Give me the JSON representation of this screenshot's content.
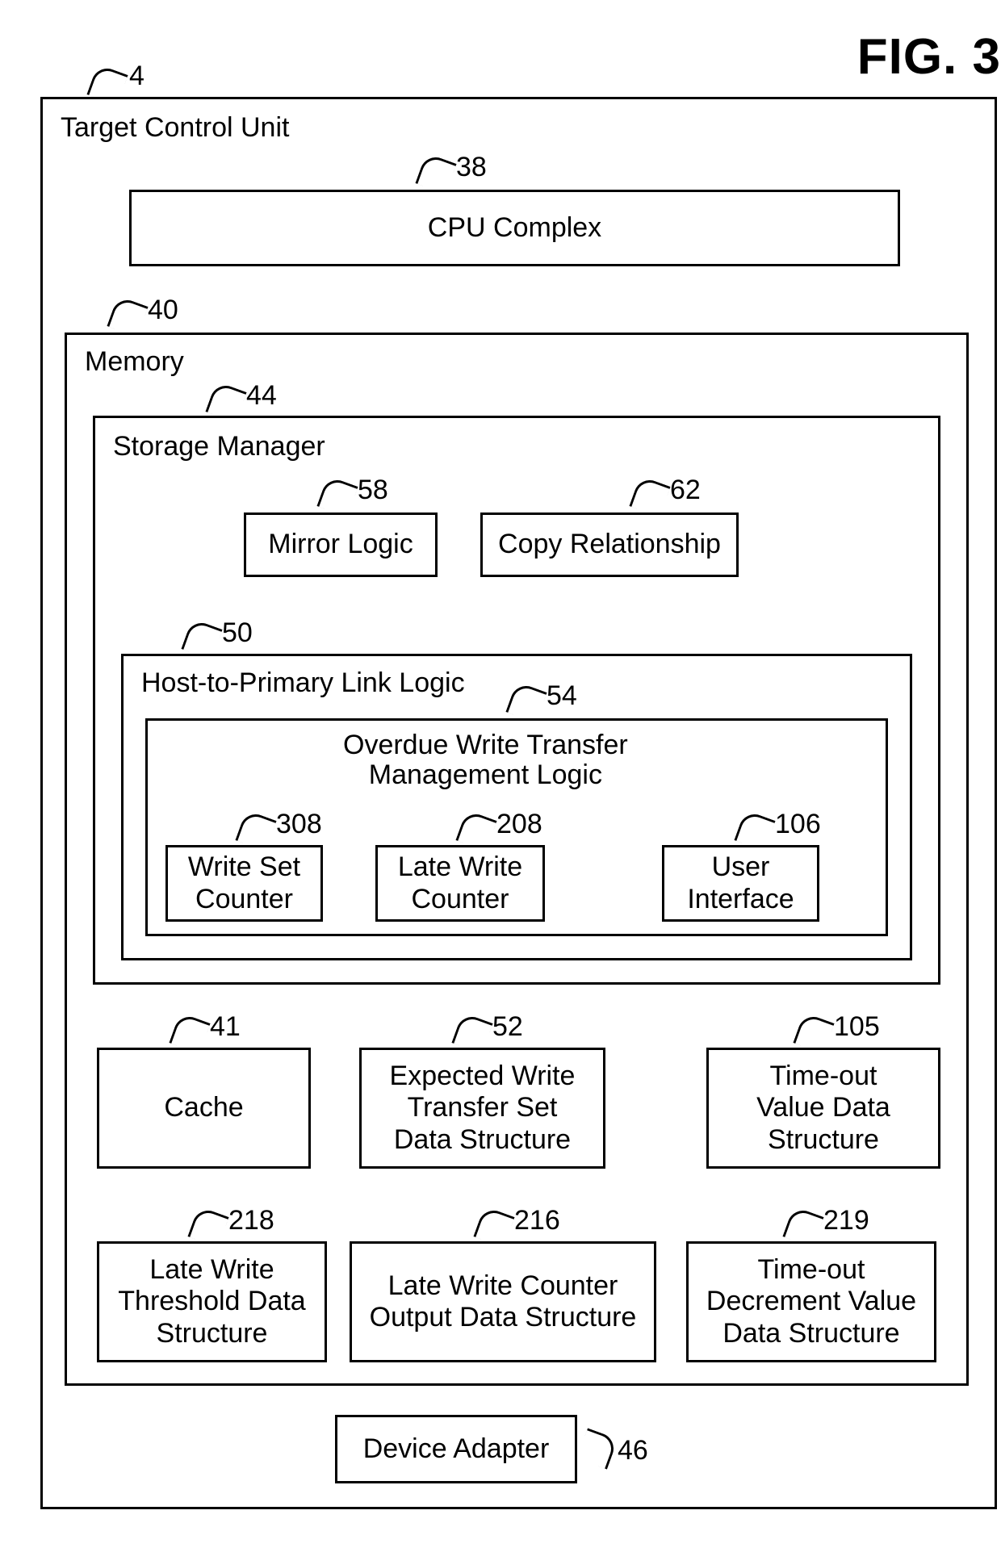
{
  "figure": "FIG. 3",
  "root": {
    "n": "4",
    "t": "Target Control Unit"
  },
  "cpu": {
    "n": "38",
    "t": "CPU Complex"
  },
  "mem": {
    "n": "40",
    "t": "Memory"
  },
  "sm": {
    "n": "44",
    "t": "Storage Manager"
  },
  "mirror": {
    "n": "58",
    "t": "Mirror Logic"
  },
  "copyrel": {
    "n": "62",
    "t": "Copy Relationship"
  },
  "hpl": {
    "n": "50",
    "t": "Host-to-Primary Link Logic"
  },
  "owt": {
    "n": "54",
    "t": "Overdue Write Transfer\nManagement Logic"
  },
  "wsc": {
    "n": "308",
    "t": "Write Set\nCounter"
  },
  "lwc": {
    "n": "208",
    "t": "Late Write\nCounter"
  },
  "ui": {
    "n": "106",
    "t": "User\nInterface"
  },
  "cache": {
    "n": "41",
    "t": "Cache"
  },
  "ewts": {
    "n": "52",
    "t": "Expected Write\nTransfer Set\nData Structure"
  },
  "tov": {
    "n": "105",
    "t": "Time-out\nValue Data\nStructure"
  },
  "lwt": {
    "n": "218",
    "t": "Late Write\nThreshold Data\nStructure"
  },
  "lwco": {
    "n": "216",
    "t": "Late Write Counter\nOutput Data Structure"
  },
  "todv": {
    "n": "219",
    "t": "Time-out\nDecrement Value\nData Structure"
  },
  "dev": {
    "n": "46",
    "t": "Device Adapter"
  }
}
